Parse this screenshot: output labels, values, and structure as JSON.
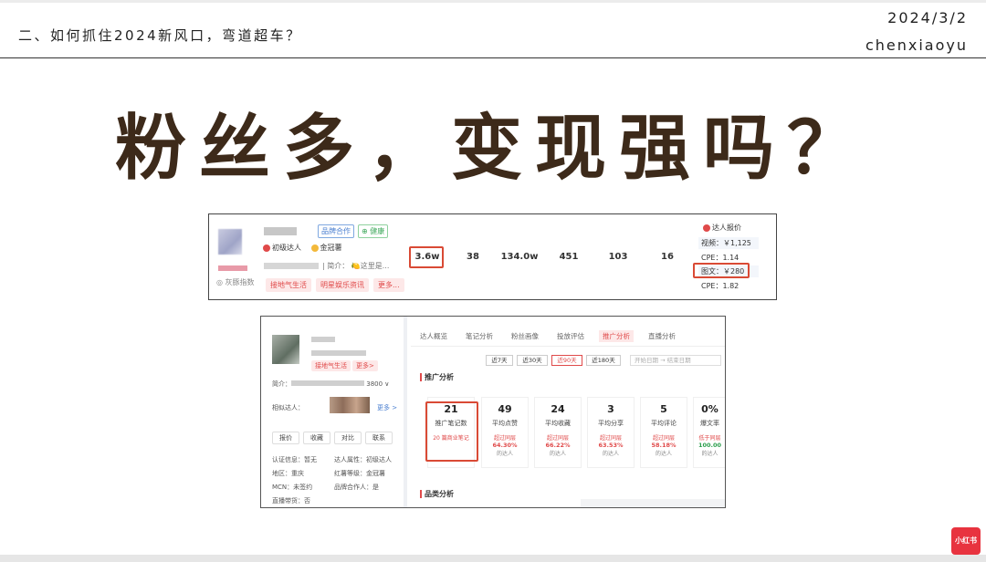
{
  "header": {
    "title": "二、如何抓住2024新风口，弯道超车？",
    "date": "2024/3/2",
    "author": "chenxiaoyu"
  },
  "main_title": "粉丝多，变现强吗？",
  "shot1": {
    "heat_label": "◎ 灰豚指数",
    "tag_brand": "品牌合作",
    "tag_health": "⊕ 健康",
    "level_primary": "初级达人",
    "level_crown": "金冠薯",
    "intro_suffix": "| 简介： 🍋这里是...",
    "chips": [
      "接地气生活",
      "明星娱乐资讯",
      "更多..."
    ],
    "metrics": [
      "3.6w",
      "38",
      "134.0w",
      "451",
      "103",
      "16"
    ],
    "price_head": "达人报价",
    "prices": {
      "video": "视频：￥1,125",
      "video_cpe": "CPE：1.14",
      "image": "图文：￥280",
      "image_cpe": "CPE：1.82"
    }
  },
  "shot2": {
    "left": {
      "chip_primary": "接地气生活",
      "chip_more": "更多>",
      "intro_label": "简介：",
      "intro_suffix": "3800 ∨",
      "similar_label": "相似达人：",
      "similar_more": "更多 >",
      "buttons": [
        "报价",
        "收藏",
        "对比",
        "联系"
      ],
      "info": [
        {
          "k": "认证信息：",
          "v": "暂无"
        },
        {
          "k": "达人属性：",
          "v": "初级达人"
        },
        {
          "k": "地区：",
          "v": "重庆"
        },
        {
          "k": "红薯等级：",
          "v": "金冠薯"
        },
        {
          "k": "MCN：",
          "v": "未签约"
        },
        {
          "k": "品牌合作人：",
          "v": "是"
        },
        {
          "k": "直播带货：",
          "v": "否"
        }
      ]
    },
    "tabs": [
      "达人概览",
      "笔记分析",
      "粉丝画像",
      "投放评估",
      "推广分析",
      "直播分析"
    ],
    "active_tab": "推广分析",
    "ranges": [
      "近7天",
      "近30天",
      "近90天",
      "近180天"
    ],
    "date_start": "开始日期",
    "date_sep": "→",
    "date_end": "结束日期",
    "section_promo": "推广分析",
    "section_category": "品类分析",
    "cards": [
      {
        "value": "21",
        "label": "推广笔记数",
        "sub1": "20 篇商业笔记",
        "sub2": "",
        "sub3": ""
      },
      {
        "value": "49",
        "label": "平均点赞",
        "sub1": "超过同层",
        "sub2": "64.30%",
        "sub3": "的达人"
      },
      {
        "value": "24",
        "label": "平均收藏",
        "sub1": "超过同层",
        "sub2": "66.22%",
        "sub3": "的达人"
      },
      {
        "value": "3",
        "label": "平均分享",
        "sub1": "超过同层",
        "sub2": "63.53%",
        "sub3": "的达人"
      },
      {
        "value": "5",
        "label": "平均评论",
        "sub1": "超过同层",
        "sub2": "58.18%",
        "sub3": "的达人"
      },
      {
        "value": "0%",
        "label": "爆文率",
        "sub1": "低于同层",
        "sub2": "100.00",
        "sub3": "的达人"
      }
    ]
  },
  "logo": "小红书"
}
